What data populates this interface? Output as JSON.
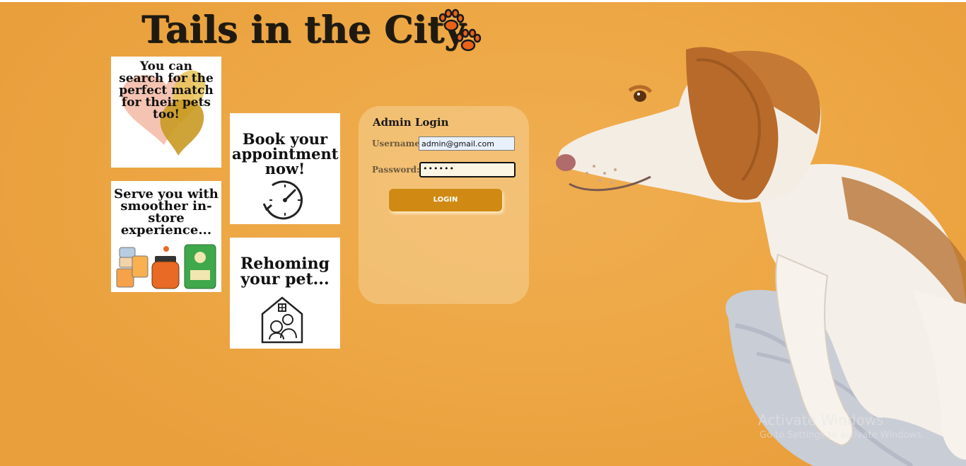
{
  "site": {
    "title": "Tails in the City"
  },
  "cards": {
    "match": "You can search for the perfect match for their pets too!",
    "appointment": "Book your appointment now!",
    "instore": "Serve you with smoother in-store experience...",
    "rehoming": "Rehoming your pet..."
  },
  "login": {
    "title": "Admin Login",
    "username_label": "Username:",
    "username_value": "admin@gmail.com",
    "password_label": "Password:",
    "password_value": "••••••",
    "button_label": "LOGIN"
  },
  "watermark": {
    "line1": "Activate Windows",
    "line2": "Go to Settings to activate Windows."
  },
  "colors": {
    "background": "#eda744",
    "button": "#d08a14",
    "paw": "#e8621a"
  }
}
